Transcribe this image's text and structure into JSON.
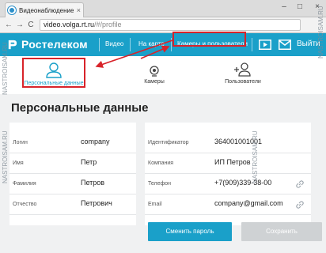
{
  "browser": {
    "tab_title": "Видеонаблюдение",
    "url_host": "video.volga.rt.ru",
    "url_path": "/#/profile",
    "close_tab_glyph": "×",
    "back_glyph": "←",
    "forward_glyph": "→",
    "reload_glyph": "C",
    "window_controls": {
      "minimize": "–",
      "maximize": "□",
      "close": "×"
    }
  },
  "header": {
    "logo_text": "Ростелеком",
    "nav": [
      "Видео",
      "На карте",
      "Камеры и пользователи"
    ],
    "active_nav": "Камеры и пользователи",
    "exit_label": "Выйти",
    "accent_color": "#1aa0c9",
    "highlight_color": "#d8232a"
  },
  "section_tabs": [
    {
      "label": "Персональные данные",
      "icon": "user-icon",
      "active": true
    },
    {
      "label": "Камеры",
      "icon": "camera-icon",
      "active": false
    },
    {
      "label": "Пользователи",
      "icon": "add-user-icon",
      "active": false
    }
  ],
  "page": {
    "title": "Персональные данные",
    "left_fields": [
      {
        "label": "Логин",
        "value": "company"
      },
      {
        "label": "Имя",
        "value": "Петр"
      },
      {
        "label": "Фамилия",
        "value": "Петров"
      },
      {
        "label": "Отчество",
        "value": "Петрович"
      }
    ],
    "right_fields": [
      {
        "label": "Идентификатор",
        "value": "364001001001"
      },
      {
        "label": "Компания",
        "value": "ИП Петров"
      },
      {
        "label": "Телефон",
        "value": "+7(909)339-38-00"
      },
      {
        "label": "Email",
        "value": "company@gmail.com"
      }
    ],
    "change_password_label": "Сменить пароль",
    "save_label": "Сохранить"
  },
  "watermark": "NASTROISAM.RU"
}
